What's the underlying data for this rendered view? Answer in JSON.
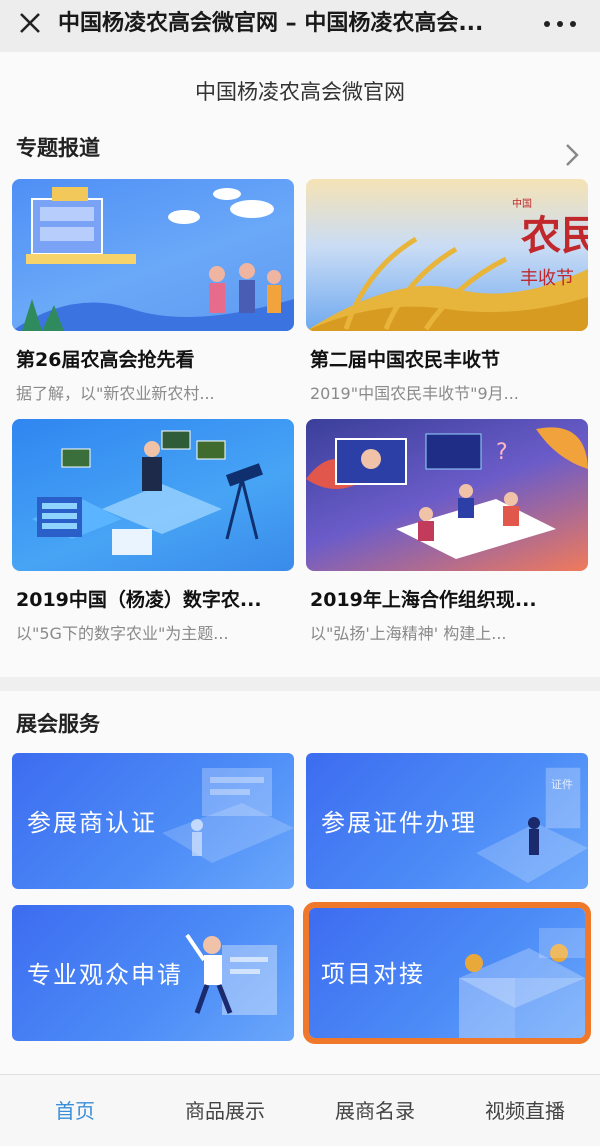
{
  "topbar": {
    "title": "中国杨凌农高会微官网 – 中国杨凌农高会..."
  },
  "site_name": "中国杨凌农高会微官网",
  "reports": {
    "heading": "专题报道",
    "items": [
      {
        "title": "第26届农高会抢先看",
        "desc": "据了解，以\"新农业新农村..."
      },
      {
        "title": "第二届中国农民丰收节",
        "desc": "2019\"中国农民丰收节\"9月..."
      },
      {
        "title": "2019中国（杨凌）数字农...",
        "desc": "以\"5G下的数字农业\"为主题..."
      },
      {
        "title": "2019年上海合作组织现...",
        "desc": "以\"弘扬'上海精神' 构建上..."
      }
    ],
    "banner_text": {
      "main": "农民",
      "sub": "丰收节",
      "tag": "中国"
    }
  },
  "services": {
    "heading": "展会服务",
    "items": [
      {
        "label": "参展商认证"
      },
      {
        "label": "参展证件办理",
        "badge": "证件"
      },
      {
        "label": "专业观众申请"
      },
      {
        "label": "项目对接"
      }
    ]
  },
  "tabbar": {
    "tabs": [
      "首页",
      "商品展示",
      "展商名录",
      "视频直播"
    ],
    "active_index": 0
  },
  "colors": {
    "accent": "#3a8fd9",
    "highlight": "#f0782a",
    "service_blue": "#3d6cf0"
  }
}
